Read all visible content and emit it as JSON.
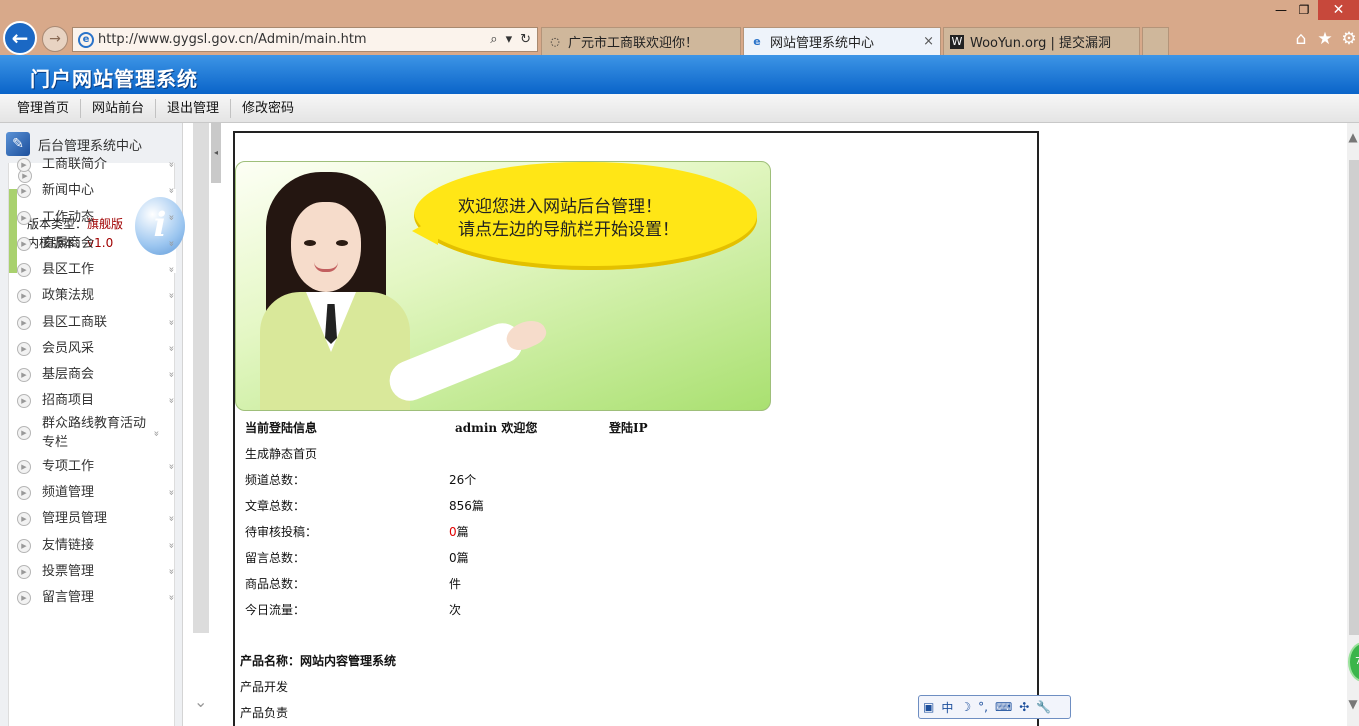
{
  "browser": {
    "address": "http://www.gygsl.gov.cn/Admin/main.htm",
    "tabs": [
      {
        "label": "广元市工商联欢迎你！",
        "icon": "loading-icon"
      },
      {
        "label": "网站管理系统中心",
        "icon": "ie-page-icon",
        "close": "×"
      },
      {
        "label": "WooYun.org | 提交漏洞",
        "icon": "wooyun-icon"
      }
    ],
    "window_controls": {
      "minimize": "—",
      "maximize": "❐",
      "close": "✕"
    },
    "icons": {
      "home": "⌂",
      "favorites": "★",
      "settings": "⚙"
    }
  },
  "site": {
    "title": "门户网站管理系统",
    "top_menu": [
      "管理首页",
      "网站前台",
      "退出管理",
      "修改密码"
    ]
  },
  "sidebar": {
    "header": "后台管理系统中心",
    "version_type_label": "版本类型：",
    "version_type_value": "旗舰版",
    "kernel_label": "内核版本：",
    "kernel_value": "v1.0",
    "items": [
      "工商联简介",
      "新闻中心",
      "工作动态",
      "直属商会",
      "县区工作",
      "政策法规",
      "县区工商联",
      "会员风采",
      "基层商会",
      "招商项目",
      "群众路线教育活动专栏",
      "专项工作",
      "频道管理",
      "管理员管理",
      "友情链接",
      "投票管理",
      "留言管理"
    ]
  },
  "banner": {
    "line1": "欢迎您进入网站后台管理！",
    "line2": "请点左边的导航栏开始设置！"
  },
  "login_info": {
    "title": "当前登陆信息",
    "user": "admin 欢迎您",
    "ip_label": "登陆IP"
  },
  "stats": {
    "generate_static": "生成静态首页",
    "rows": [
      {
        "label": "频道总数：",
        "value": "26个"
      },
      {
        "label": "文章总数：",
        "value": "856篇"
      },
      {
        "label": "待审核投稿：",
        "value_red": "0",
        "value": "篇"
      },
      {
        "label": "留言总数：",
        "value": "0篇"
      },
      {
        "label": "商品总数：",
        "value": "件"
      },
      {
        "label": "今日流量：",
        "value": "次"
      }
    ]
  },
  "product": {
    "name": "产品名称：网站内容管理系统",
    "dev": "产品开发",
    "owner": "产品负责"
  },
  "ime": {
    "lang": "中",
    "moon": "☽",
    "punct": "°,",
    "keyboard": "⌨",
    "tools": "✣",
    "wrench": "🔧"
  }
}
